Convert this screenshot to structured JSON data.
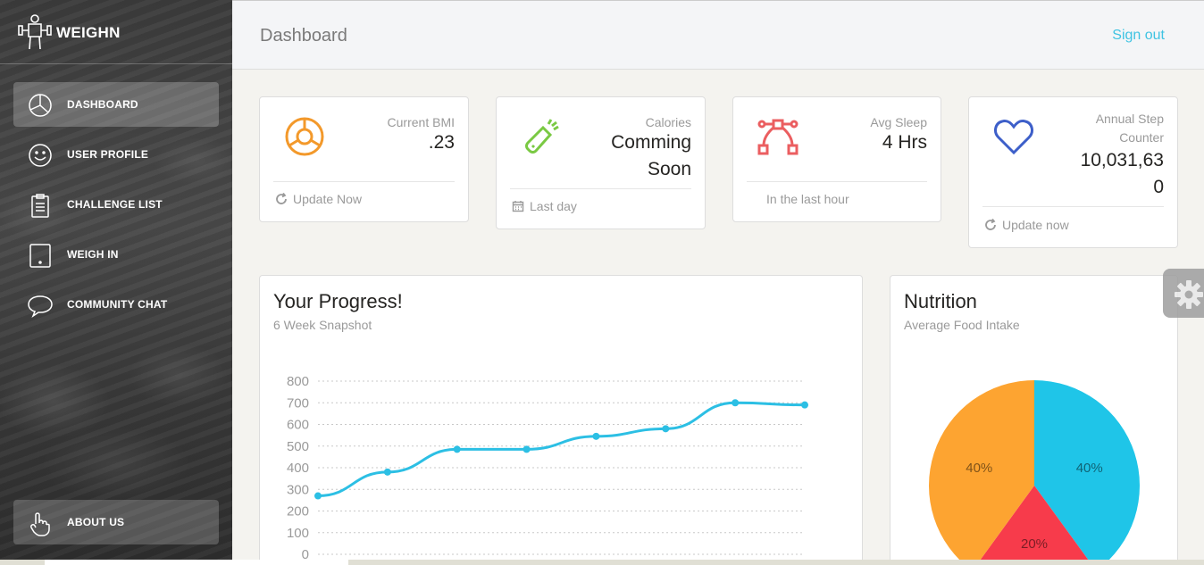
{
  "app": {
    "name": "WEIGHN"
  },
  "sidebar": {
    "items": [
      {
        "label": "DASHBOARD",
        "icon": "pie-chart-icon",
        "active": true
      },
      {
        "label": "USER PROFILE",
        "icon": "smiley-icon",
        "active": false
      },
      {
        "label": "CHALLENGE LIST",
        "icon": "clipboard-icon",
        "active": false
      },
      {
        "label": "WEIGH IN",
        "icon": "tablet-icon",
        "active": false
      },
      {
        "label": "COMMUNITY CHAT",
        "icon": "chat-bubble-icon",
        "active": false
      }
    ],
    "bottom": {
      "label": "ABOUT US",
      "icon": "hand-pointer-icon"
    }
  },
  "header": {
    "title": "Dashboard",
    "signout": "Sign out"
  },
  "stats": [
    {
      "category": "Current BMI",
      "value": ".23",
      "footer": "Update Now",
      "footer_icon": "refresh-icon",
      "icon": "donut-chart-icon",
      "color": "#f3992b"
    },
    {
      "category": "Calories",
      "value": "Comming Soon",
      "footer": "Last day",
      "footer_icon": "calendar-icon",
      "icon": "flashlight-icon",
      "color": "#7ac943"
    },
    {
      "category": "Avg Sleep",
      "value": "4 Hrs",
      "footer": "In the last hour",
      "footer_icon": "",
      "icon": "vector-path-icon",
      "color": "#eb5e60"
    },
    {
      "category": "Annual Step Counter",
      "value": "10,031,630",
      "footer": "Update now",
      "footer_icon": "refresh-icon",
      "icon": "heart-icon",
      "color": "#3d5fc9"
    }
  ],
  "progress": {
    "title": "Your Progress!",
    "subtitle": "6 Week Snapshot",
    "chart_data": {
      "type": "line",
      "y": [
        270,
        380,
        485,
        485,
        545,
        580,
        700,
        690
      ],
      "ylim": [
        0,
        800
      ],
      "yticks": [
        0,
        100,
        200,
        300,
        400,
        500,
        600,
        700,
        800
      ],
      "grid": true,
      "color": "#2cbfe4"
    }
  },
  "nutrition": {
    "title": "Nutrition",
    "subtitle": "Average Food Intake",
    "chart_data": {
      "type": "pie",
      "values": [
        40,
        20,
        40
      ],
      "labels": [
        "40%",
        "20%",
        "40%"
      ],
      "colors": [
        "#1fc5e8",
        "#f73b4b",
        "#fda431"
      ]
    }
  }
}
